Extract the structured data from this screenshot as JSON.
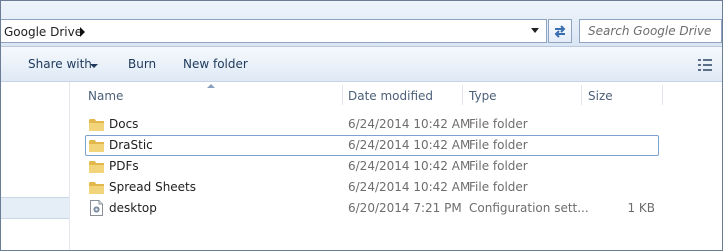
{
  "address_bar": {
    "breadcrumb": "Google Drive",
    "search_placeholder": "Search Google Drive"
  },
  "toolbar": {
    "share_with": "Share with",
    "burn": "Burn",
    "new_folder": "New folder"
  },
  "columns": {
    "name": "Name",
    "date_modified": "Date modified",
    "type": "Type",
    "size": "Size"
  },
  "files": [
    {
      "name": "Docs",
      "date": "6/24/2014 10:42 AM",
      "type": "File folder",
      "size": "",
      "icon": "folder-icon"
    },
    {
      "name": "DraStic",
      "date": "6/24/2014 10:42 AM",
      "type": "File folder",
      "size": "",
      "icon": "folder-icon"
    },
    {
      "name": "PDFs",
      "date": "6/24/2014 10:42 AM",
      "type": "File folder",
      "size": "",
      "icon": "folder-icon"
    },
    {
      "name": "Spread Sheets",
      "date": "6/24/2014 10:42 AM",
      "type": "File folder",
      "size": "",
      "icon": "folder-icon"
    },
    {
      "name": "desktop",
      "date": "6/20/2014 7:21 PM",
      "type": "Configuration sett...",
      "size": "1 KB",
      "icon": "config-file-icon"
    }
  ],
  "colors": {
    "toolbar_text": "#1e395b",
    "folder": "#e8c35a",
    "focus_border": "#7da2ce"
  }
}
